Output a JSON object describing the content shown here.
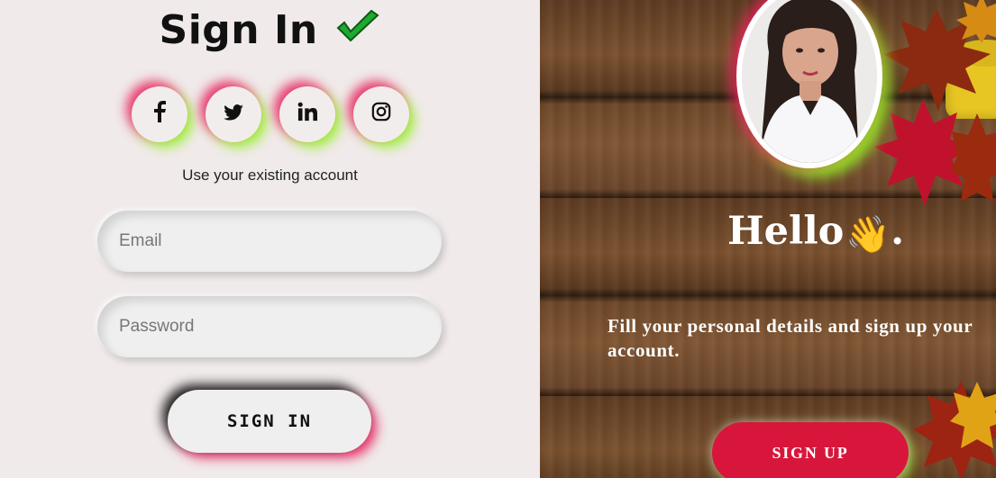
{
  "left": {
    "title": "Sign In",
    "title_icon": "green-checkmark-icon",
    "social": [
      {
        "name": "facebook",
        "glyph": "f",
        "icon": "facebook-icon"
      },
      {
        "name": "twitter",
        "glyph": "twitter-bird",
        "icon": "twitter-icon"
      },
      {
        "name": "linkedin",
        "glyph": "in",
        "icon": "linkedin-icon"
      },
      {
        "name": "instagram",
        "glyph": "instagram-camera",
        "icon": "instagram-icon"
      }
    ],
    "subtitle": "Use your existing account",
    "email_placeholder": "Email",
    "password_placeholder": "Password",
    "signin_label": "SIGN IN"
  },
  "right": {
    "hello_text": "Hello",
    "hello_emoji": "👋",
    "hello_suffix": ".",
    "tagline": "Fill your personal details and sign up your account.",
    "signup_label": "SIGN UP"
  },
  "colors": {
    "left_bg": "#f0eaea",
    "accent_red": "#d8163b",
    "glow_pink": "#e61e5a",
    "glow_green": "#96f028"
  }
}
